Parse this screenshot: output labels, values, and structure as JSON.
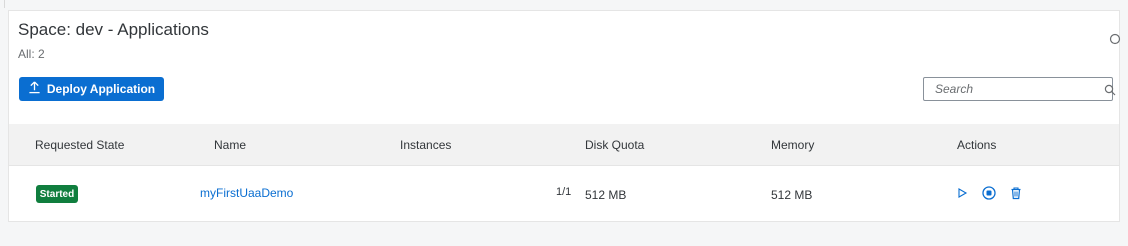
{
  "header": {
    "title": "Space: dev - Applications",
    "count_label": "All: 2"
  },
  "toolbar": {
    "deploy_label": "Deploy Application",
    "search_placeholder": "Search"
  },
  "table": {
    "columns": [
      "Requested State",
      "Name",
      "Instances",
      "Disk Quota",
      "Memory",
      "Actions"
    ],
    "rows": [
      {
        "state": "Started",
        "name": "myFirstUaaDemo",
        "instances": "1/1",
        "disk_quota": "512 MB",
        "memory": "512 MB",
        "actions": [
          "play-icon",
          "stop-icon",
          "delete-icon"
        ]
      }
    ]
  },
  "colors": {
    "accent": "#0a6ed1",
    "status_started": "#107e3e"
  }
}
